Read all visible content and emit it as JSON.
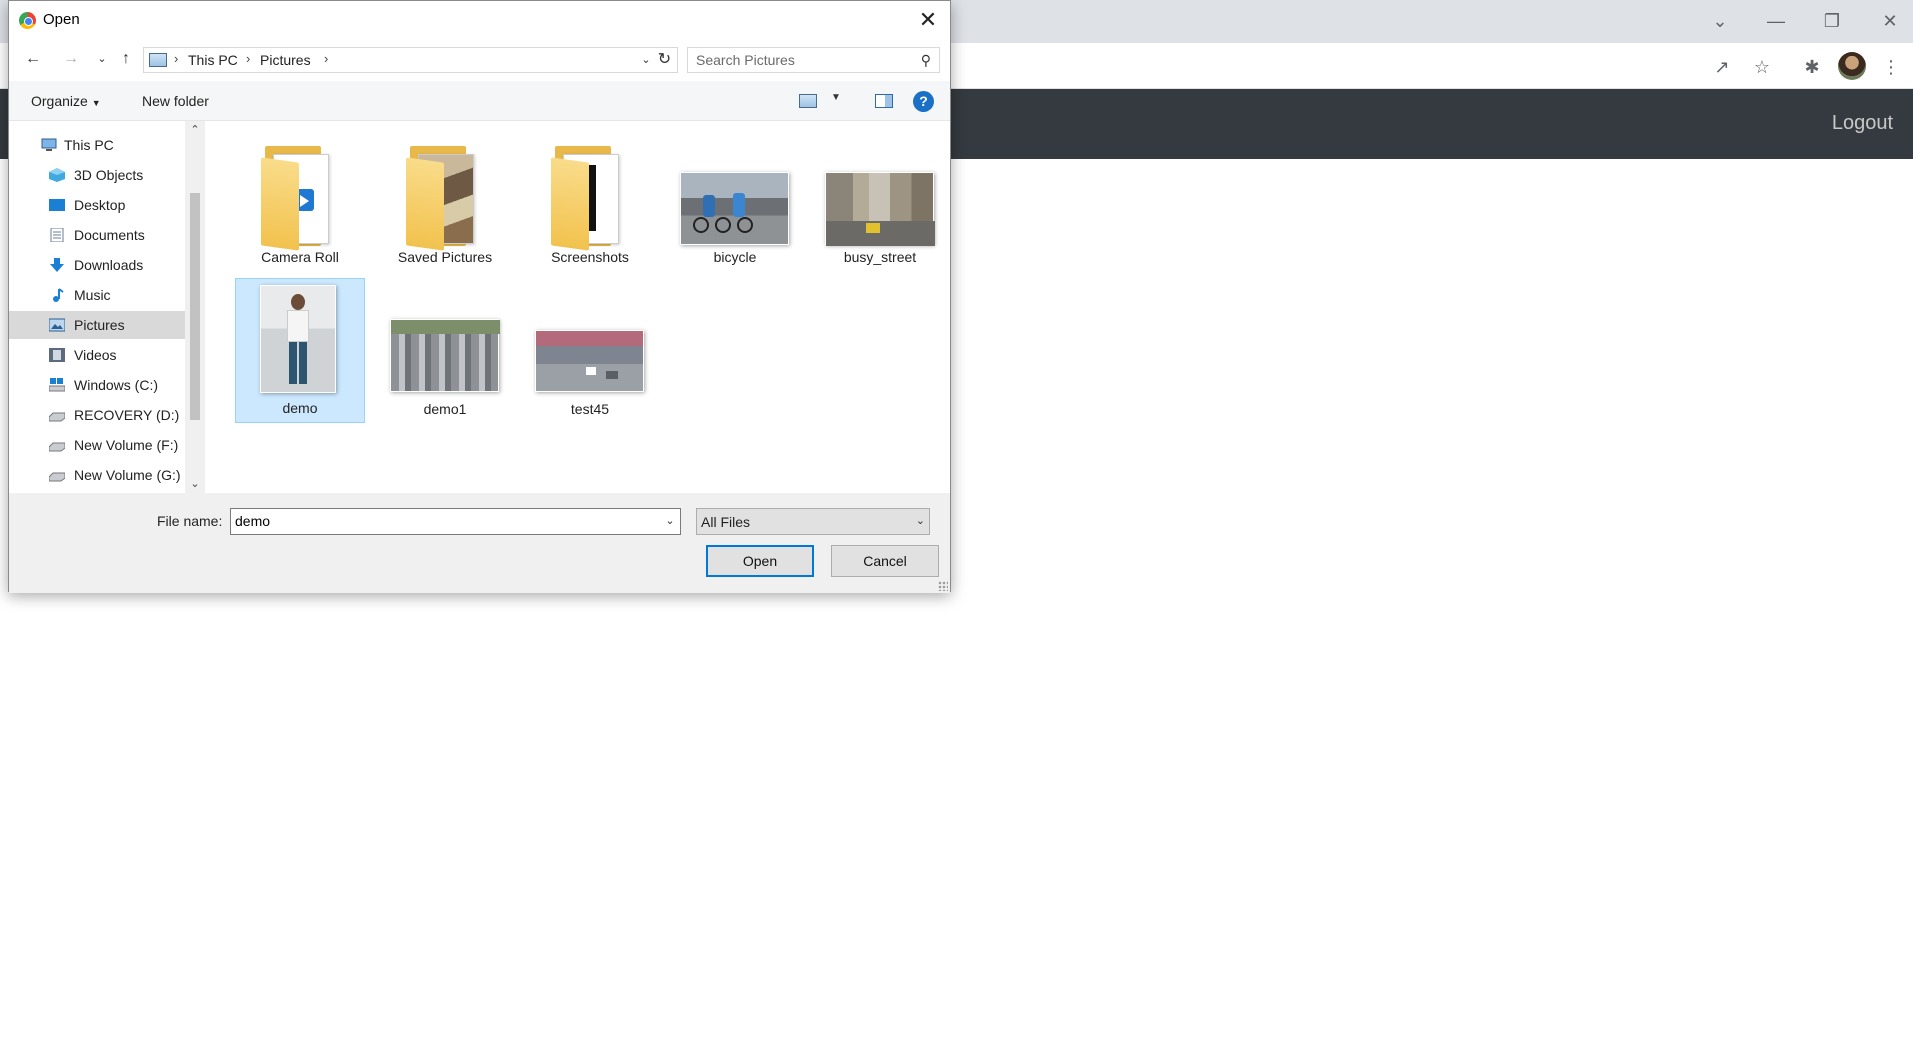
{
  "browser": {
    "header": {
      "logout_label": "Logout"
    },
    "icons": [
      "share-icon",
      "star-icon",
      "extensions-icon",
      "avatar",
      "menu-icon"
    ],
    "window_controls": [
      "chevron-down-icon",
      "minimize-icon",
      "restore-icon",
      "close-icon"
    ]
  },
  "dialog": {
    "title": "Open",
    "breadcrumb": [
      "This PC",
      "Pictures"
    ],
    "search_placeholder": "Search Pictures",
    "commands": {
      "organize": "Organize",
      "new_folder": "New folder"
    },
    "nav_items": [
      {
        "label": "This PC",
        "icon": "computer-icon"
      },
      {
        "label": "3D Objects",
        "icon": "cube-icon"
      },
      {
        "label": "Desktop",
        "icon": "desktop-icon"
      },
      {
        "label": "Documents",
        "icon": "document-icon"
      },
      {
        "label": "Downloads",
        "icon": "download-icon"
      },
      {
        "label": "Music",
        "icon": "music-icon"
      },
      {
        "label": "Pictures",
        "icon": "pictures-icon",
        "selected": true
      },
      {
        "label": "Videos",
        "icon": "video-icon"
      },
      {
        "label": "Windows (C:)",
        "icon": "drive-icon"
      },
      {
        "label": "RECOVERY (D:)",
        "icon": "drive-icon"
      },
      {
        "label": "New Volume (F:)",
        "icon": "drive-icon"
      },
      {
        "label": "New Volume (G:)",
        "icon": "drive-icon"
      }
    ],
    "files": [
      {
        "name": "Camera Roll",
        "type": "folder"
      },
      {
        "name": "Saved Pictures",
        "type": "folder"
      },
      {
        "name": "Screenshots",
        "type": "folder"
      },
      {
        "name": "bicycle",
        "type": "image"
      },
      {
        "name": "busy_street",
        "type": "image"
      },
      {
        "name": "demo",
        "type": "image",
        "selected": true
      },
      {
        "name": "demo1",
        "type": "image"
      },
      {
        "name": "test45",
        "type": "image"
      }
    ],
    "file_name_label": "File name:",
    "file_name_value": "demo",
    "file_type": "All Files",
    "open_label": "Open",
    "cancel_label": "Cancel"
  },
  "colors": {
    "accent": "#0078d7",
    "selection": "#cce8ff",
    "header_bg": "#343a40"
  }
}
